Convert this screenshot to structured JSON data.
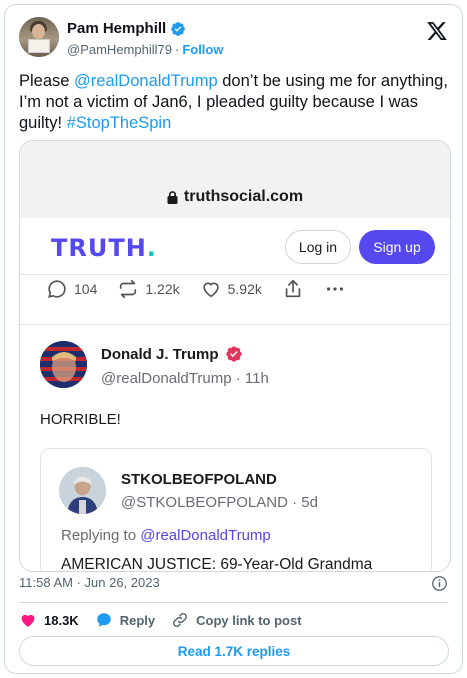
{
  "tweet": {
    "author_name": "Pam Hemphill",
    "author_handle": "@PamHemphill79",
    "separator": "·",
    "follow_label": "Follow",
    "text_parts": {
      "p1": "Please ",
      "mention": "@realDonaldTrump",
      "p2": " don’t be using me for anything, I’m not a victim of Jan6, I pleaded guilty because I was guilty! ",
      "hashtag": "#StopTheSpin"
    },
    "timestamp": "11:58 AM · Jun 26, 2023",
    "likes": "18.3K",
    "reply_label": "Reply",
    "copy_label": "Copy link to post",
    "read_replies_label": "Read 1.7K replies"
  },
  "embed": {
    "url": "truthsocial.com",
    "logo_text": "TRUTH",
    "logo_dot": ".",
    "login_label": "Log in",
    "signup_label": "Sign up",
    "actions": {
      "replies": "104",
      "retruths": "1.22k",
      "likes": "5.92k"
    },
    "post": {
      "name": "Donald J. Trump",
      "handle": "@realDonaldTrump · 11h",
      "text": "HORRIBLE!"
    },
    "quote": {
      "name": "STKOLBEOFPOLAND",
      "handle": "@STKOLBEOFPOLAND · 5d",
      "replying_prefix": "Replying to ",
      "replying_handle": "@realDonaldTrump",
      "text": "AMERICAN JUSTICE: 69-Year-Old Grandma"
    }
  },
  "colors": {
    "twitter_blue": "#1d9bf0",
    "truth_purple": "#5448ee",
    "like_pink": "#f91880"
  },
  "icons": [
    "verified-badge-icon",
    "x-logo-icon",
    "lock-icon",
    "reply-icon",
    "retruth-icon",
    "heart-icon",
    "share-icon",
    "more-icon",
    "truth-verified-icon",
    "info-icon",
    "like-heart-icon",
    "reply-bubble-icon",
    "link-icon"
  ]
}
